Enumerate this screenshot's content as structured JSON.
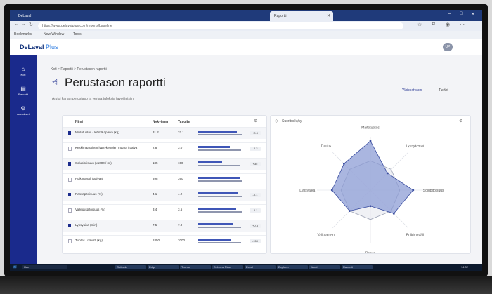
{
  "browser": {
    "tabs": [
      "DeLaval",
      "Raportti"
    ],
    "url": "https://www.delavalplus.com/reports/baseline",
    "bookmarks": [
      "Bookmarks",
      "New Window",
      "Tools"
    ]
  },
  "app": {
    "logo_main": "DeLaval",
    "logo_plus": "Plus",
    "avatar_initials": "UP"
  },
  "sidebar": {
    "items": [
      {
        "label": "Koti",
        "icon": "home-icon"
      },
      {
        "label": "Raportit",
        "icon": "report-icon"
      },
      {
        "label": "Asetukset",
        "icon": "settings-icon"
      }
    ]
  },
  "breadcrumb": "Koti  >  Raportit  >  Perustason raportti",
  "page_title": "Perustason raportti",
  "subtitle": "Arvioi karjan perustaso ja vertaa tuloksia tavoitteisiin",
  "view_tabs": [
    "Yleiskatsaus",
    "Tiedot"
  ],
  "table": {
    "headers": [
      "Nimi",
      "Nykyinen",
      "Tavoite"
    ],
    "rows": [
      {
        "name": "Maitotuotos / lehmä / päivä (kg)",
        "v1": "31.2",
        "v2": "32.1",
        "pct": 0.88,
        "badge": "+0.9",
        "icon": "solid"
      },
      {
        "name": "Keskimääräinen lypsykertojen määrä / päivä",
        "v1": "2.8",
        "v2": "3.0",
        "pct": 0.72,
        "badge": "-0.2",
        "icon": "outline"
      },
      {
        "name": "Solupitoisuus (x1000 / ml)",
        "v1": "185",
        "v2": "150",
        "pct": 0.55,
        "badge": "+35",
        "icon": "solid"
      },
      {
        "name": "Poikimaväli (päivää)",
        "v1": "398",
        "v2": "390",
        "pct": 0.95,
        "badge": "",
        "icon": "outline"
      },
      {
        "name": "Rasvapitoisuus (%)",
        "v1": "4.1",
        "v2": "4.2",
        "pct": 0.9,
        "badge": "-0.1",
        "icon": "solid"
      },
      {
        "name": "Valkuaispitoisuus (%)",
        "v1": "3.4",
        "v2": "3.5",
        "pct": 0.86,
        "badge": "-0.1",
        "icon": "outline"
      },
      {
        "name": "Lypsyaika (min)",
        "v1": "7.5",
        "v2": "7.0",
        "pct": 0.8,
        "badge": "+0.5",
        "icon": "solid"
      },
      {
        "name": "Tuotos / robotti (kg)",
        "v1": "1850",
        "v2": "2000",
        "pct": 0.75,
        "badge": "-150",
        "icon": "outline"
      }
    ]
  },
  "radar": {
    "title": "Suorituskyky",
    "axis_labels": [
      "Maitotuotos",
      "Lypsykerrat",
      "Solupitoisuus",
      "Poikimaväli",
      "Rasva",
      "Valkuainen",
      "Lypsyaika",
      "Tuotos"
    ],
    "series": [
      {
        "values": [
          0.92,
          0.45,
          0.8,
          0.62,
          0.3,
          0.55,
          0.72,
          0.7
        ]
      },
      {
        "values": [
          0.55,
          0.55,
          0.55,
          0.55,
          0.55,
          0.55,
          0.55,
          0.55
        ]
      }
    ]
  },
  "taskbar": {
    "search": "Hae",
    "apps": [
      "Outlook",
      "Edge",
      "Teams",
      "DeLaval Plus",
      "Excel",
      "Explorer",
      "Word",
      "Raportti"
    ],
    "clock": "14.32"
  },
  "colors": {
    "primary": "#1a2a8c",
    "bar": "#3f56b7",
    "radar_fill": "#8e9ed6"
  }
}
